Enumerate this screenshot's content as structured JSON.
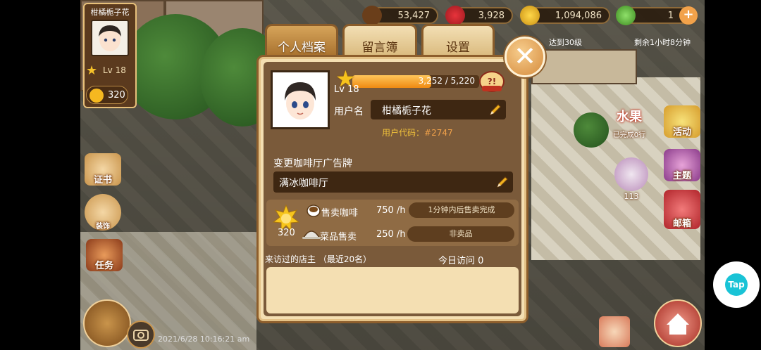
{
  "hud": {
    "profile_name": "柑橘栀子花",
    "profile_level": "Lv 18",
    "coins_small": "320",
    "coffee_beans": "53,427",
    "hearts": "3,928",
    "gold": "1,094,086",
    "energy": "1",
    "quest_text": "达到30级",
    "timer_text": "剩余1小时8分钟",
    "date_stamp": "2021/6/28 10:16:21 am"
  },
  "side_icons": {
    "left": [
      "证书",
      "装饰",
      "任务"
    ],
    "right": [
      "活动",
      "主题",
      "邮箱"
    ],
    "fruit_label": "水果",
    "fruit_sub": "已完成0行",
    "count_113": "113"
  },
  "tabs": [
    {
      "label": "个人档案"
    },
    {
      "label": "留言簿"
    },
    {
      "label": "设置"
    }
  ],
  "profile": {
    "level": "Lv 18",
    "xp_text": "3,252 / 5,220",
    "xp_fraction": 0.623,
    "username_label": "用户名",
    "username": "柑橘栀子花",
    "user_code_label": "用户代码：",
    "user_code": "#2747",
    "sign_label": "变更咖啡厅广告牌",
    "sign_value": "满冰咖啡厅"
  },
  "sales": {
    "sun_count": "320",
    "coffee_label": "售卖咖啡",
    "coffee_rate": "750 /h",
    "coffee_status": "1分钟内后售卖完成",
    "dish_label": "菜品售卖",
    "dish_rate": "250 /h",
    "dish_status": "非卖品"
  },
  "visitors": {
    "header": "来访过的店主 （最近20名）",
    "today": "今日访问 0"
  },
  "overlay": {
    "tap_label": "Tap"
  },
  "colors": {
    "accent": "#ef8a12",
    "panel_dark": "#3e2712",
    "panel_mid": "#7a5a3a",
    "panel_light": "#f4dfb2",
    "uid_color": "#f2c33a"
  }
}
